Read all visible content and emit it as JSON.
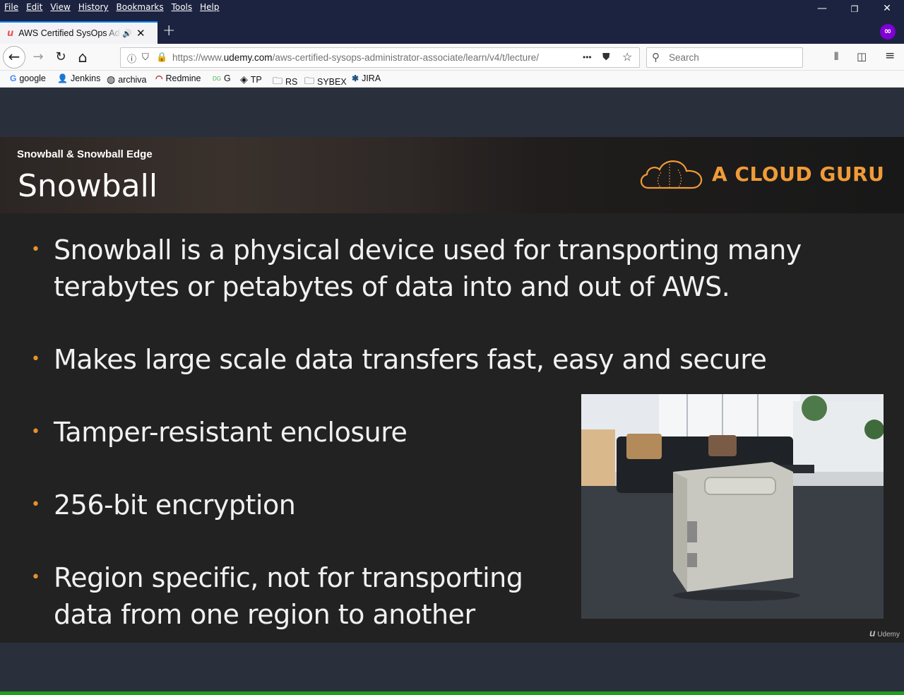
{
  "menubar": {
    "items": [
      "File",
      "Edit",
      "View",
      "History",
      "Bookmarks",
      "Tools",
      "Help"
    ],
    "minimize": "—",
    "restore": "❐",
    "close": "✕"
  },
  "tab": {
    "favicon": "u",
    "title": "AWS Certified SysOps Administrator",
    "speaker": "🔊",
    "close": "✕"
  },
  "new_tab": "+",
  "nav": {
    "back": "←",
    "forward": "→",
    "reload": "↻",
    "home": "⌂",
    "url_prefix": "https://www.",
    "url_domain": "udemy.com",
    "url_path": "/aws-certified-sysops-administrator-associate/learn/v4/t/lecture/",
    "page_actions": "•••",
    "search_placeholder": "Search"
  },
  "bookmarks": [
    {
      "icon": "G",
      "label": "google",
      "color": "#4285f4"
    },
    {
      "icon": "👤",
      "label": "Jenkins",
      "color": "#c0392b"
    },
    {
      "icon": "◍",
      "label": "archiva",
      "color": "#333333"
    },
    {
      "icon": "◠",
      "label": "Redmine",
      "color": "#b32024"
    },
    {
      "icon": "DG",
      "label": "G",
      "color": "#4caf50"
    },
    {
      "icon": "◈",
      "label": "TP",
      "color": "#333333"
    },
    {
      "icon": "🗀",
      "label": "RS",
      "color": "#333333"
    },
    {
      "icon": "🗀",
      "label": "SYBEX",
      "color": "#333333"
    },
    {
      "icon": "✱",
      "label": "JIRA",
      "color": "#205081"
    }
  ],
  "slide": {
    "subtitle": "Snowball & Snowball Edge",
    "heading": "Snowball",
    "logo_text": "A CLOUD GURU",
    "bullets": [
      {
        "lines": [
          "Snowball is a physical device used for transporting many",
          "terabytes or petabytes of data into and out of AWS."
        ]
      },
      {
        "lines": [
          "Makes large scale data transfers fast, easy and secure"
        ]
      },
      {
        "lines": [
          "Tamper-resistant enclosure"
        ]
      },
      {
        "lines": [
          "256-bit encryption"
        ]
      },
      {
        "lines": [
          "Region specific, not for transporting",
          "data from one region to another"
        ]
      }
    ],
    "bullet_char": "•",
    "watermark_logo": "u",
    "watermark_text": "Udemy"
  }
}
